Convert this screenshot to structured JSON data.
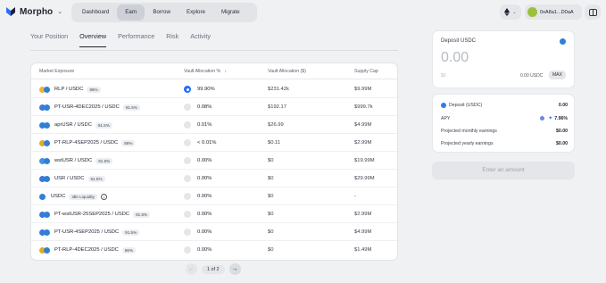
{
  "header": {
    "logo_text": "Morpho",
    "nav": [
      "Dashboard",
      "Earn",
      "Borrow",
      "Explore",
      "Migrate"
    ],
    "active_nav": "Earn",
    "chain_icon": "ethereum-icon",
    "wallet_address": "0xA8a1...D0aA"
  },
  "tabs": [
    "Your Position",
    "Overview",
    "Performance",
    "Risk",
    "Activity"
  ],
  "active_tab": "Overview",
  "table": {
    "headers": {
      "market": "Market Exposure",
      "alloc_pct": "Vault Allocation %",
      "alloc_usd": "Vault Allocation ($)",
      "supply_cap": "Supply Cap"
    },
    "rows": [
      {
        "market": "RLP / USDC",
        "badge": "86%",
        "pct": "99.90%",
        "usd": "$231.42k",
        "cap": "$9.99M"
      },
      {
        "market": "PT-USR-4DEC2025 / USDC",
        "badge": "91.5%",
        "pct": "0.08%",
        "usd": "$192.17",
        "cap": "$999.7k"
      },
      {
        "market": "aprUSR / USDC",
        "badge": "91.5%",
        "pct": "0.01%",
        "usd": "$26.99",
        "cap": "$4.99M"
      },
      {
        "market": "PT-RLP-4SEP2025 / USDC",
        "badge": "86%",
        "pct": "< 0.01%",
        "usd": "$0.11",
        "cap": "$2.99M"
      },
      {
        "market": "wstUSR / USDC",
        "badge": "91.5%",
        "pct": "0.00%",
        "usd": "$0",
        "cap": "$19.99M"
      },
      {
        "market": "USR / USDC",
        "badge": "91.5%",
        "pct": "0.00%",
        "usd": "$0",
        "cap": "$29.99M"
      },
      {
        "market": "USDC",
        "badge": "Idle Liquidity",
        "pct": "0.00%",
        "usd": "$0",
        "cap": "-"
      },
      {
        "market": "PT-wstUSR-25SEP2025 / USDC",
        "badge": "91.5%",
        "pct": "0.00%",
        "usd": "$0",
        "cap": "$2.99M"
      },
      {
        "market": "PT-USR-4SEP2025 / USDC",
        "badge": "91.5%",
        "pct": "0.00%",
        "usd": "$0",
        "cap": "$4.99M"
      },
      {
        "market": "PT-RLP-4DEC2025 / USDC",
        "badge": "86%",
        "pct": "0.00%",
        "usd": "$0",
        "cap": "$1.49M"
      }
    ]
  },
  "pagination": {
    "text": "1 of 2"
  },
  "deposit": {
    "title": "Deposit USDC",
    "amount": "0.00",
    "usd": "$0",
    "balance": "0.00 USDC",
    "max_label": "MAX"
  },
  "summary": {
    "deposit_label": "Deposit (USDC)",
    "deposit_value": "0.00",
    "apy_label": "APY",
    "apy_value": "7.96%",
    "monthly_label": "Projected monthly earnings",
    "monthly_value": "$0.00",
    "yearly_label": "Projected yearly earnings",
    "yearly_value": "$0.00"
  },
  "enter_button": "Enter an amount"
}
